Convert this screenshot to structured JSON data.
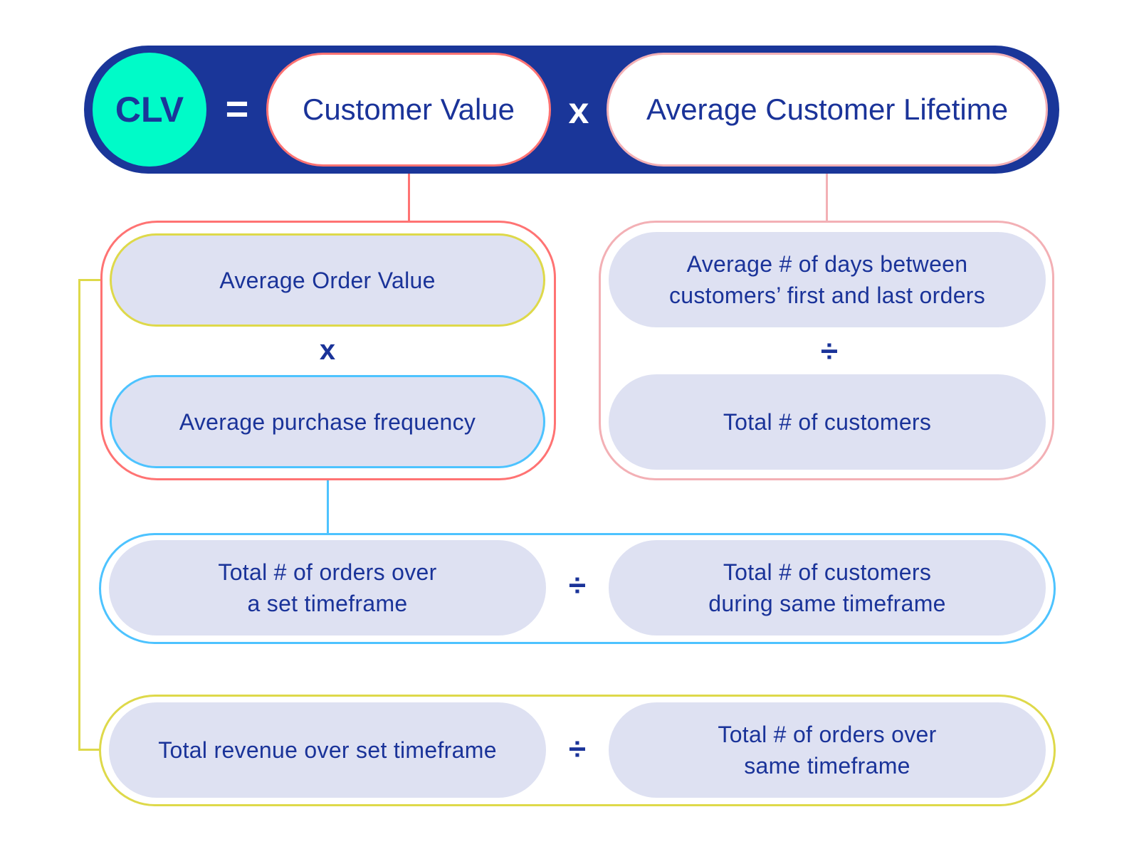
{
  "colors": {
    "navy": "#1a3699",
    "teal": "#00fbc8",
    "red": "#ff7373",
    "pink": "#f3b0b5",
    "yellow": "#ded94a",
    "blue": "#4dc3ff",
    "pill_fill": "#dee1f2",
    "text": "#1a3399"
  },
  "formula": {
    "clv": "CLV",
    "equals": "=",
    "customer_value": "Customer Value",
    "times": "x",
    "average_customer_lifetime": "Average Customer Lifetime"
  },
  "customer_value_group": {
    "average_order_value": "Average Order Value",
    "operator": "x",
    "average_purchase_frequency": "Average purchase frequency"
  },
  "lifetime_group": {
    "days_between_orders": "Average # of days between\ncustomers’ first and last orders",
    "operator": "÷",
    "total_customers": "Total # of customers"
  },
  "frequency_row": {
    "total_orders": "Total # of orders over\na set timeframe",
    "operator": "÷",
    "total_customers_timeframe": "Total # of customers\nduring same timeframe"
  },
  "order_value_row": {
    "total_revenue": "Total revenue over set timeframe",
    "operator": "÷",
    "total_orders_same": "Total # of orders over\nsame timeframe"
  }
}
